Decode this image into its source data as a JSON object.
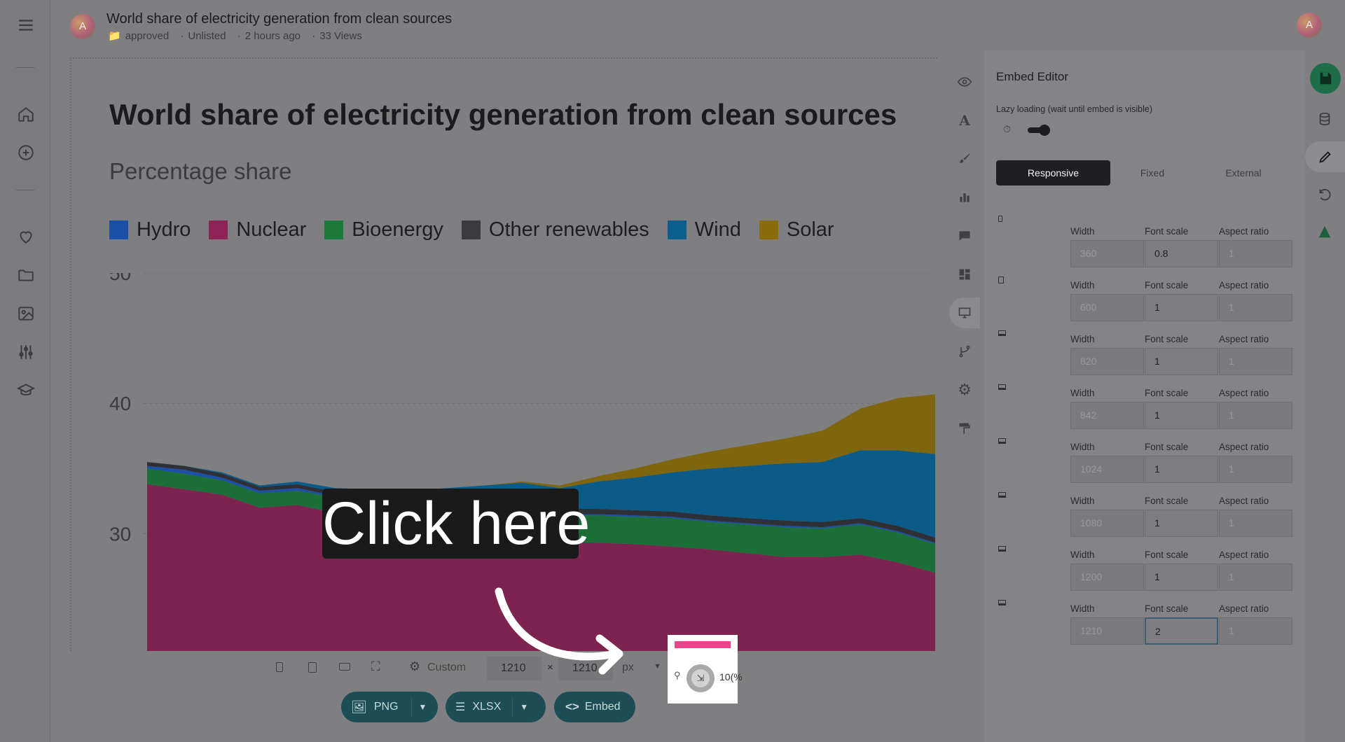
{
  "header": {
    "avatar_initial": "A",
    "title": "World share of electricity generation from clean sources",
    "folder": "approved",
    "visibility": "Unlisted",
    "updated": "2 hours ago",
    "views": "33 Views"
  },
  "chart": {
    "title": "World share of electricity generation from clean sources",
    "subtitle": "Percentage share",
    "legend": [
      {
        "name": "Hydro",
        "color": "#1c4fa8"
      },
      {
        "name": "Nuclear",
        "color": "#8e2456"
      },
      {
        "name": "Bioenergy",
        "color": "#1b7a3a"
      },
      {
        "name": "Other renewables",
        "color": "#3a3a40"
      },
      {
        "name": "Wind",
        "color": "#0b5f8f"
      },
      {
        "name": "Solar",
        "color": "#8a6c0a"
      }
    ]
  },
  "chart_data": {
    "type": "area",
    "stacked": true,
    "title": "World share of electricity generation from clean sources",
    "subtitle": "Percentage share",
    "xlabel": "",
    "ylabel": "",
    "yticks": [
      "50",
      "40",
      "30"
    ],
    "ylim": [
      21,
      50
    ],
    "grid": true,
    "legend_position": "top",
    "x": [
      0,
      1,
      2,
      3,
      4,
      5,
      6,
      7,
      8,
      9,
      10,
      11,
      12,
      13,
      14,
      15,
      16,
      17,
      18,
      19,
      20,
      21
    ],
    "series": [
      {
        "name": "Nuclear",
        "color": "#7d2350",
        "values": [
          12.8,
          12.4,
          12.0,
          11.0,
          11.2,
          10.6,
          10.3,
          9.8,
          9.7,
          9.4,
          9.3,
          8.4,
          8.3,
          8.2,
          8.0,
          7.8,
          7.5,
          7.2,
          7.2,
          7.4,
          6.8,
          6.0
        ]
      },
      {
        "name": "Bioenergy",
        "color": "#1b6e38",
        "values": [
          1.2,
          1.2,
          1.1,
          1.1,
          1.1,
          1.2,
          1.3,
          1.5,
          1.6,
          1.7,
          1.8,
          2.0,
          2.1,
          2.1,
          2.2,
          2.1,
          2.2,
          2.3,
          2.2,
          2.3,
          2.3,
          2.2
        ]
      },
      {
        "name": "Hydro",
        "color": "#1c4fa8",
        "values": [
          0.2,
          0.3,
          0.2,
          0.2,
          0.2,
          0.1,
          0.1,
          0.1,
          0.1,
          0.1,
          0.1,
          0.1,
          0.1,
          0.1,
          0.1,
          0.1,
          0.1,
          0.1,
          0.1,
          0.1,
          0.1,
          0.1
        ]
      },
      {
        "name": "Other renewables",
        "color": "#2f2f36",
        "values": [
          0.3,
          0.3,
          0.3,
          0.3,
          0.3,
          0.3,
          0.3,
          0.3,
          0.3,
          0.4,
          0.4,
          0.4,
          0.4,
          0.4,
          0.4,
          0.4,
          0.4,
          0.4,
          0.4,
          0.4,
          0.4,
          0.4
        ]
      },
      {
        "name": "Wind",
        "color": "#0a5b88",
        "values": [
          0.0,
          0.0,
          0.1,
          0.1,
          0.2,
          0.3,
          0.4,
          0.6,
          0.8,
          1.1,
          1.3,
          1.6,
          2.1,
          2.5,
          3.0,
          3.6,
          4.0,
          4.4,
          4.6,
          5.2,
          5.8,
          6.4
        ]
      },
      {
        "name": "Solar",
        "color": "#7f650d",
        "values": [
          0.0,
          0.0,
          0.0,
          0.0,
          0.0,
          0.0,
          0.0,
          0.0,
          0.0,
          0.0,
          0.1,
          0.2,
          0.4,
          0.7,
          1.0,
          1.3,
          1.6,
          1.9,
          2.4,
          3.2,
          4.0,
          4.6
        ]
      }
    ]
  },
  "toolbar": {
    "preset": "Custom",
    "width": "1210",
    "height": "1210",
    "times": "×",
    "unit": "px",
    "export_png": "PNG",
    "export_xlsx": "XLSX",
    "export_embed": "Embed"
  },
  "panel": {
    "title": "Embed Editor",
    "lazy_label": "Lazy loading (wait until embed is visible)",
    "lazy_enabled": true,
    "modes": [
      "Responsive",
      "Fixed",
      "External"
    ],
    "active_mode": "Responsive",
    "col_width": "Width",
    "col_font": "Font scale",
    "col_aspect": "Aspect ratio",
    "breakpoints": [
      {
        "width": "360",
        "font": "0.8",
        "aspect": "1",
        "device": "mobile"
      },
      {
        "width": "600",
        "font": "1",
        "aspect": "1",
        "device": "tablet"
      },
      {
        "width": "820",
        "font": "1",
        "aspect": "1",
        "device": "laptop"
      },
      {
        "width": "842",
        "font": "1",
        "aspect": "1",
        "device": "laptop"
      },
      {
        "width": "1024",
        "font": "1",
        "aspect": "1",
        "device": "laptop"
      },
      {
        "width": "1080",
        "font": "1",
        "aspect": "1",
        "device": "laptop"
      },
      {
        "width": "1200",
        "font": "1",
        "aspect": "1",
        "device": "laptop"
      },
      {
        "width": "1210",
        "font": "2",
        "aspect": "1",
        "device": "laptop"
      }
    ]
  },
  "overlay": {
    "callout": "Click here",
    "zoom_pct": "10(%"
  }
}
